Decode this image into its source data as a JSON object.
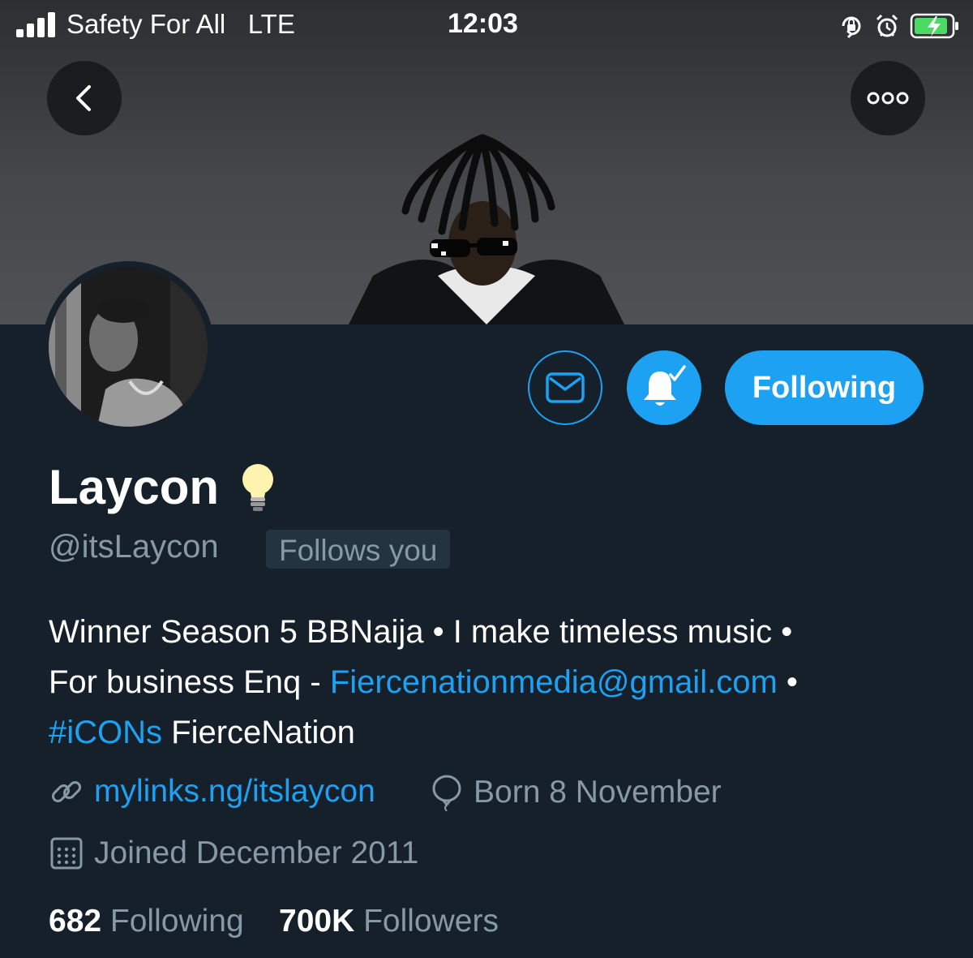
{
  "status_bar": {
    "carrier": "Safety For All",
    "network": "LTE",
    "time": "12:03",
    "icons": [
      "orientation-lock-icon",
      "alarm-icon",
      "battery-charging-icon"
    ],
    "battery_color": "#4cd964"
  },
  "header": {
    "back_icon": "chevron-left-icon",
    "more_icon": "more-horizontal-icon"
  },
  "profile": {
    "name": "Laycon",
    "name_emoji": "💡",
    "handle": "@itsLaycon",
    "follows_you": "Follows you",
    "actions": {
      "message_icon": "envelope-icon",
      "notifications_icon": "bell-check-icon",
      "following_label": "Following"
    },
    "bio": {
      "line1": "Winner Season 5 BBNaija • I make timeless music •",
      "line2_prefix": "For business Enq - ",
      "email": "Fiercenationmedia@gmail.com",
      "line2_suffix": " •",
      "hashtag": "#iCONs",
      "line3_suffix": " FierceNation"
    },
    "website": "mylinks.ng/itslaycon",
    "birthday": "Born 8 November",
    "joined": "Joined December 2011",
    "stats": {
      "following_count": "682",
      "following_label": "Following",
      "followers_count": "700K",
      "followers_label": "Followers"
    }
  },
  "colors": {
    "background": "#15202b",
    "accent": "#1da1f2",
    "secondary_text": "#8899a6"
  }
}
